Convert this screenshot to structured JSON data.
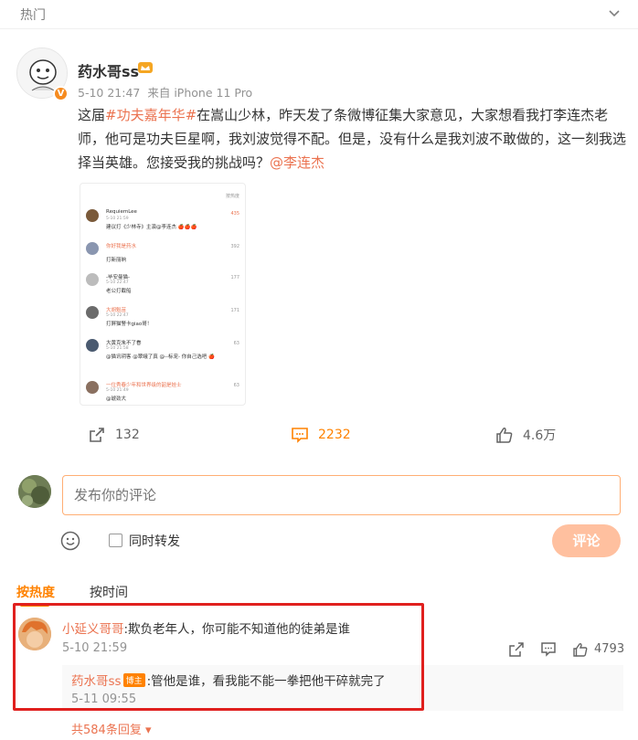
{
  "topbar": {
    "title": "热门",
    "chevron_icon": "chevron-down-icon"
  },
  "post": {
    "username": "药水哥ss",
    "verified_badge": "V",
    "time": "5-10 21:47",
    "source": "来自 iPhone 11 Pro",
    "text_parts": {
      "t1": "这届",
      "tag": "#功夫嘉年华#",
      "t2": "在嵩山少林，昨天发了条微博征集大家意见，大家想看我打李连杰老师，他可是功夫巨星啊，我刘波觉得不配。但是，没有什么是我刘波不敢做的，这一刻我选择当英雄。您接受我的挑战吗？",
      "mention": "@李连杰"
    },
    "image": {
      "sort_label": "按热度",
      "comments": [
        {
          "name": "RequiemLee",
          "time": "5-10 21:59",
          "text": "建议打《少林寺》主演@李连杰 🍎🍎🍎",
          "likes": "435"
        },
        {
          "name": "你好我是药水",
          "time": "",
          "text": "打新丽晌",
          "likes": "392"
        },
        {
          "name": "-毕安曼猫-",
          "time": "5-10 22:47",
          "text": "老公打截船",
          "likes": "177"
        },
        {
          "name": "大胡魁苗",
          "time": "5-10 22:47",
          "text": "打屏猫警卡giao哥！",
          "likes": "171"
        },
        {
          "name": "大黄克朱不了眷",
          "time": "5-10 21:58",
          "text": "@猫讯玥客 @翠蛾了真 @--标宠- 你自己选吧 🍎",
          "likes": "63"
        },
        {
          "name": "一位秀春少年和世界级的韶是娃士",
          "time": "5-10 21:49",
          "text": "@琥劲大",
          "likes": "63"
        }
      ]
    },
    "actions": {
      "repost": "132",
      "comment": "2232",
      "like": "4.6万"
    }
  },
  "composer": {
    "placeholder": "发布你的评论",
    "repost_label": "同时转发",
    "submit_label": "评论"
  },
  "sort_tabs": {
    "hot": "按热度",
    "time": "按时间"
  },
  "comment": {
    "name": "小延义哥哥",
    "text": ":欺负老年人，你可能不知道他的徒弟是谁",
    "time": "5-10 21:59",
    "likes": "4793",
    "reply": {
      "name": "药水哥ss",
      "owner_tag": "博主",
      "text": ":管他是谁，看我能不能一拳把他干碎就完了",
      "time": "5-11 09:55"
    },
    "more_replies": "共584条回复"
  },
  "colors": {
    "accent": "#ff8200",
    "link": "#eb7350",
    "highlight_box": "#e0201e"
  }
}
